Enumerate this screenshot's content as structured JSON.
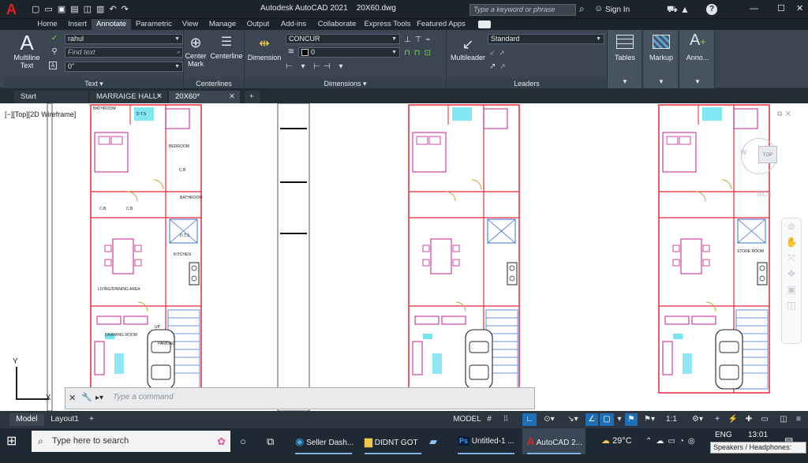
{
  "app": {
    "title": "Autodesk AutoCAD 2021",
    "file": "20X60.dwg",
    "logo_letter": "A"
  },
  "titlebar": {
    "search_placeholder": "Type a keyword or phrase",
    "signin": "Sign In",
    "help": "?",
    "win_min": "—",
    "win_max": "☐",
    "win_close": "✕"
  },
  "ribbon_tabs": [
    "Home",
    "Insert",
    "Annotate",
    "Parametric",
    "View",
    "Manage",
    "Output",
    "Add-ins",
    "Collaborate",
    "Express Tools",
    "Featured Apps"
  ],
  "ribbon": {
    "text_panel": {
      "multiline_text": "Multiline Text",
      "style_value": "rahul",
      "find_placeholder": "Find text",
      "height_value": "0\"",
      "label": "Text"
    },
    "centerlines_panel": {
      "center_mark": "Center Mark",
      "centerline": "Centerline",
      "label": "Centerlines"
    },
    "dimensions_panel": {
      "dimension": "Dimension",
      "dimstyle_value": "CONCUR",
      "layer_value": "0",
      "label": "Dimensions"
    },
    "leaders_panel": {
      "multileader": "Multileader",
      "style_value": "Standard",
      "label": "Leaders"
    },
    "tables": "Tables",
    "markup": "Markup",
    "annotation": "Anno..."
  },
  "doc_tabs": [
    {
      "label": "Start"
    },
    {
      "label": "MARRAIGE HALL*"
    },
    {
      "label": "20X60*"
    }
  ],
  "viewport": {
    "label": "[−][Top][2D Wireframe]",
    "viewcube_top": "TOP",
    "viewcube_w": "W",
    "wcs": "WCS",
    "command_placeholder": "Type a command",
    "axis_y": "Y",
    "axis_x": "X"
  },
  "rooms": [
    "BATHROOM",
    "D.T.S",
    "BEDROOM",
    "C.B",
    "BATHROOM",
    "C.B",
    "C.B",
    "D.T.S",
    "KITCHEN",
    "LIVING/DINNING AREA",
    "DRAWING ROOM",
    "PARKING",
    "UP",
    "STORE ROOM"
  ],
  "layout_tabs": [
    "Model",
    "Layout1"
  ],
  "status": {
    "model": "MODEL",
    "scale": "1:1"
  },
  "taskbar": {
    "search": "Type here to search",
    "apps": [
      "Seller Dash...",
      "DIDNT GOT",
      "Untitled-1 ...",
      "AutoCAD 2..."
    ],
    "weather": "29°C",
    "lang": "ENG",
    "time": "13:01",
    "tooltip": "Speakers / Headphones: 72%"
  }
}
